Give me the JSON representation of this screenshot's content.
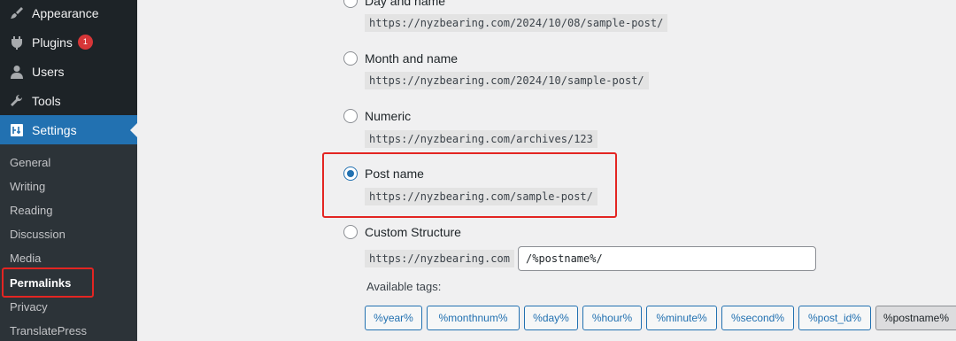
{
  "sidebar": {
    "menu": [
      {
        "label": "Appearance",
        "icon": "paintbrush-icon"
      },
      {
        "label": "Plugins",
        "icon": "plug-icon",
        "badge": "1"
      },
      {
        "label": "Users",
        "icon": "user-icon"
      },
      {
        "label": "Tools",
        "icon": "wrench-icon"
      },
      {
        "label": "Settings",
        "icon": "settings-icon",
        "active": true
      }
    ],
    "submenu": [
      "General",
      "Writing",
      "Reading",
      "Discussion",
      "Media",
      "Permalinks",
      "Privacy",
      "TranslatePress"
    ],
    "current_submenu": "Permalinks"
  },
  "permalinks": {
    "options": [
      {
        "label": "Day and name",
        "example": "https://nyzbearing.com/2024/10/08/sample-post/"
      },
      {
        "label": "Month and name",
        "example": "https://nyzbearing.com/2024/10/sample-post/"
      },
      {
        "label": "Numeric",
        "example": "https://nyzbearing.com/archives/123"
      },
      {
        "label": "Post name",
        "example": "https://nyzbearing.com/sample-post/",
        "selected": true
      },
      {
        "label": "Custom Structure",
        "example": "https://nyzbearing.com"
      }
    ],
    "custom_value": "/%postname%/",
    "available_tags_label": "Available tags:",
    "tags": [
      "%year%",
      "%monthnum%",
      "%day%",
      "%hour%",
      "%minute%",
      "%second%",
      "%post_id%",
      "%postname%"
    ],
    "pressed_tag": "%postname%"
  },
  "colors": {
    "sidebar_bg": "#1d2327",
    "accent": "#2271b1",
    "highlight_red": "#e32522",
    "badge_red": "#d63638"
  }
}
